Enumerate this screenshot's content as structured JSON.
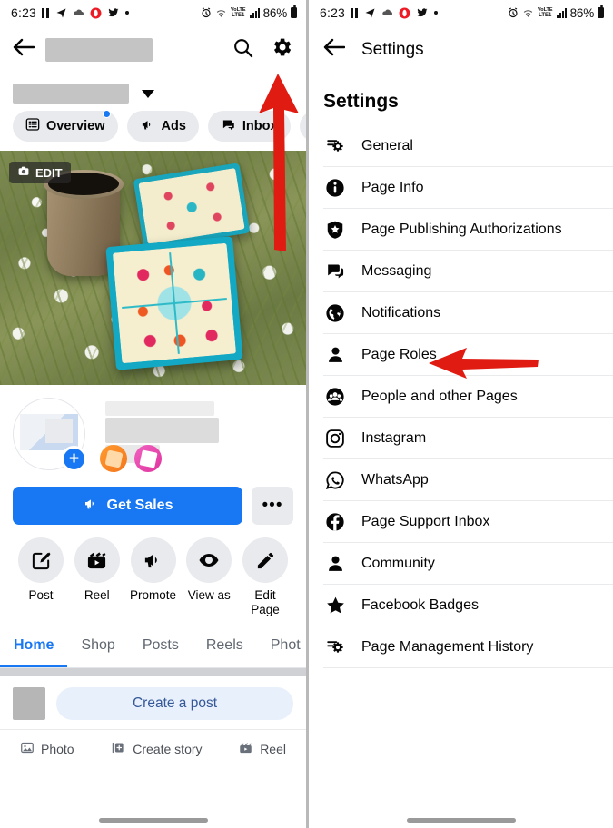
{
  "status_bar": {
    "time": "6:23",
    "battery": "86%",
    "network": "LTE1",
    "volte": "VoLTE",
    "icons": [
      "pause-icon",
      "telegram-icon",
      "cloud-upload-icon",
      "opera-icon",
      "twitter-icon",
      "dot-icon",
      "alarm-icon",
      "wifi-icon",
      "volte-icon",
      "signal-icon",
      "battery-icon"
    ]
  },
  "left_panel": {
    "header": {
      "back_icon": "back-arrow-icon",
      "title_redacted": "",
      "search_icon": "search-icon",
      "settings_icon": "gear-icon"
    },
    "page_selector": {
      "name_redacted": "",
      "caret_icon": "chevron-down-icon"
    },
    "chips": [
      {
        "label": "Overview",
        "icon": "list-icon",
        "badge": true
      },
      {
        "label": "Ads",
        "icon": "megaphone-icon",
        "badge": false
      },
      {
        "label": "Inbox",
        "icon": "chat-icon",
        "badge": false
      },
      {
        "label": "",
        "icon": "partial-icon",
        "badge": false
      }
    ],
    "cover": {
      "edit_label": "EDIT",
      "camera_icon": "camera-icon"
    },
    "profile": {
      "add_icon": "plus-icon",
      "mini_icons": [
        "orange-badge-icon",
        "pink-clipboard-icon"
      ]
    },
    "cta": {
      "label": "Get Sales",
      "icon": "megaphone-icon",
      "more_label": "•••"
    },
    "quick_actions": [
      {
        "label": "Post",
        "icon": "compose-icon"
      },
      {
        "label": "Reel",
        "icon": "reel-icon"
      },
      {
        "label": "Promote",
        "icon": "megaphone-icon"
      },
      {
        "label": "View as",
        "icon": "eye-icon"
      },
      {
        "label": "Edit Page",
        "icon": "pencil-icon"
      }
    ],
    "nav_tabs": [
      {
        "label": "Home",
        "active": true
      },
      {
        "label": "Shop",
        "active": false
      },
      {
        "label": "Posts",
        "active": false
      },
      {
        "label": "Reels",
        "active": false
      },
      {
        "label": "Phot",
        "active": false
      }
    ],
    "composer": {
      "placeholder": "Create a post",
      "actions": [
        {
          "label": "Photo",
          "icon": "photo-icon"
        },
        {
          "label": "Create story",
          "icon": "create-story-icon"
        },
        {
          "label": "Reel",
          "icon": "reel-icon"
        }
      ]
    }
  },
  "right_panel": {
    "header": {
      "back_icon": "back-arrow-icon",
      "title": "Settings"
    },
    "page_title": "Settings",
    "items": [
      {
        "label": "General",
        "icon": "sliders-gear-icon"
      },
      {
        "label": "Page Info",
        "icon": "info-circle-icon"
      },
      {
        "label": "Page Publishing Authorizations",
        "icon": "shield-star-icon"
      },
      {
        "label": "Messaging",
        "icon": "chat-bubbles-icon"
      },
      {
        "label": "Notifications",
        "icon": "globe-icon"
      },
      {
        "label": "Page Roles",
        "icon": "person-icon"
      },
      {
        "label": "People and other Pages",
        "icon": "people-circle-icon"
      },
      {
        "label": "Instagram",
        "icon": "instagram-icon"
      },
      {
        "label": "WhatsApp",
        "icon": "whatsapp-icon"
      },
      {
        "label": "Page Support Inbox",
        "icon": "facebook-icon"
      },
      {
        "label": "Community",
        "icon": "person-icon"
      },
      {
        "label": "Facebook Badges",
        "icon": "star-icon"
      },
      {
        "label": "Page Management History",
        "icon": "sliders-gear-icon"
      }
    ]
  },
  "annotations": {
    "arrow_color": "#e01b12",
    "arrow_up_target": "gear-icon",
    "arrow_left_target": "Page Roles"
  },
  "colors": {
    "accent_blue": "#1877f2",
    "chip_bg": "#e9eaed",
    "text_primary": "#050505",
    "text_secondary": "#606770",
    "divider": "#e4e6eb",
    "arrow_red": "#e01b12"
  }
}
